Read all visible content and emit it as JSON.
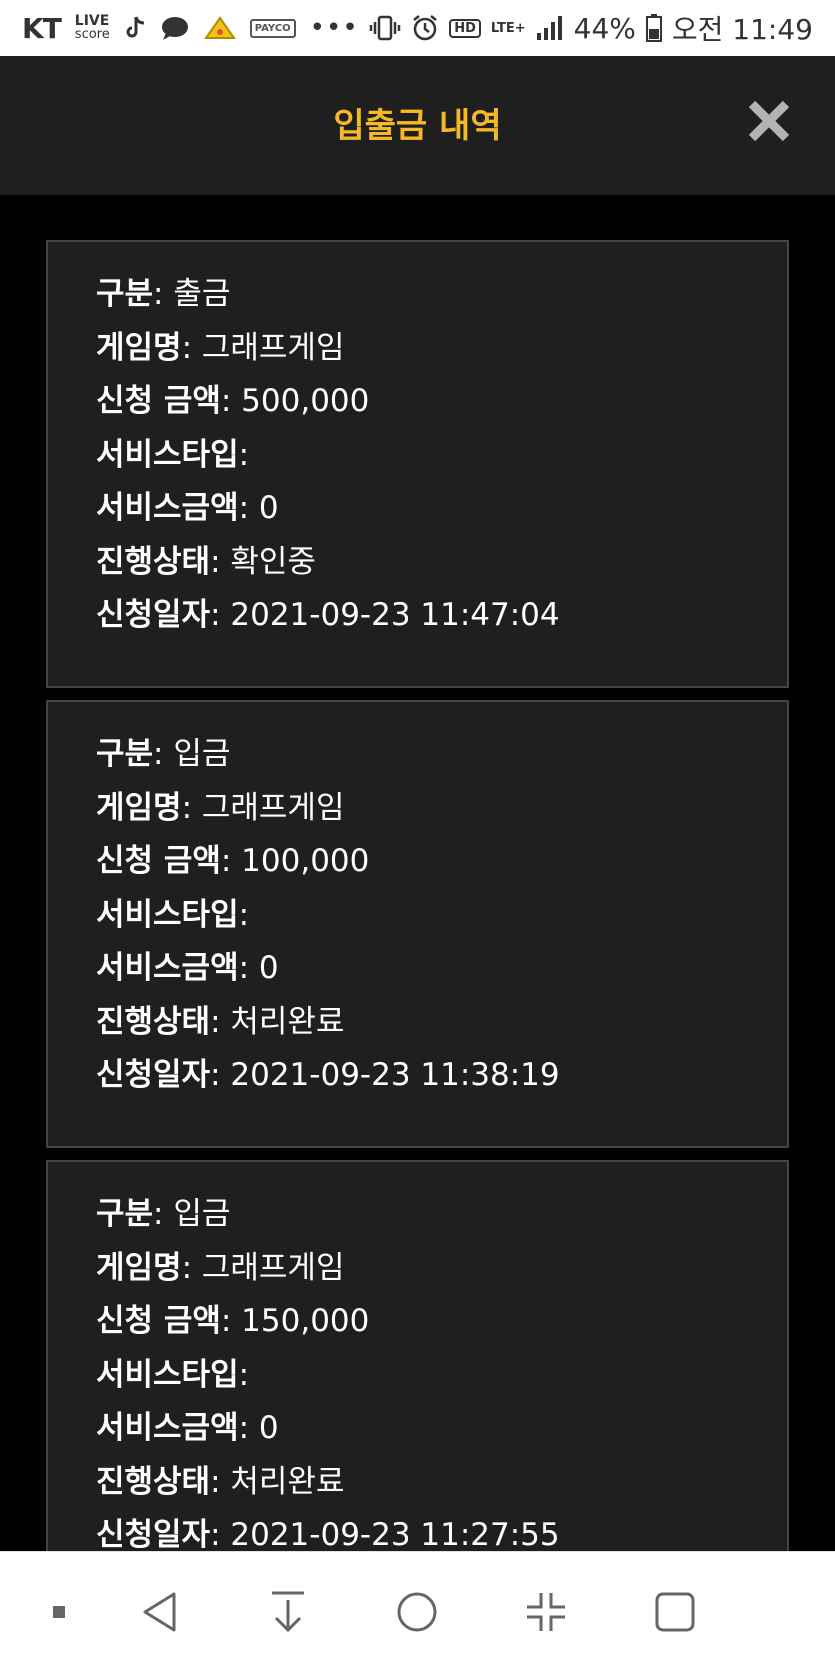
{
  "status_bar": {
    "carrier": "KT",
    "livescore_top": "LIVE",
    "livescore_bottom": "score",
    "payco": "PAYCO",
    "more": "•••",
    "hd": "HD",
    "lte": "LTE+",
    "battery": "44%",
    "time": "오전 11:49"
  },
  "header": {
    "title": "입출금 내역"
  },
  "labels": {
    "type": "구분",
    "game": "게임명",
    "amount": "신청 금액",
    "service_type": "서비스타입",
    "service_amount": "서비스금액",
    "status": "진행상태",
    "date": "신청일자"
  },
  "colors": {
    "accent": "#f5b928",
    "card_bg": "#1f1f1f",
    "page_bg": "#000000"
  },
  "transactions": [
    {
      "type": ": 출금",
      "game": ": 그래프게임",
      "amount": ": 500,000",
      "service_type": ":",
      "service_amount": ": 0",
      "status": ": 확인중",
      "date": ": 2021-09-23 11:47:04"
    },
    {
      "type": ": 입금",
      "game": ": 그래프게임",
      "amount": ": 100,000",
      "service_type": ":",
      "service_amount": ": 0",
      "status": ": 처리완료",
      "date": ": 2021-09-23 11:38:19"
    },
    {
      "type": ": 입금",
      "game": ": 그래프게임",
      "amount": ": 150,000",
      "service_type": ":",
      "service_amount": ": 0",
      "status": ": 처리완료",
      "date": ": 2021-09-23 11:27:55"
    }
  ]
}
